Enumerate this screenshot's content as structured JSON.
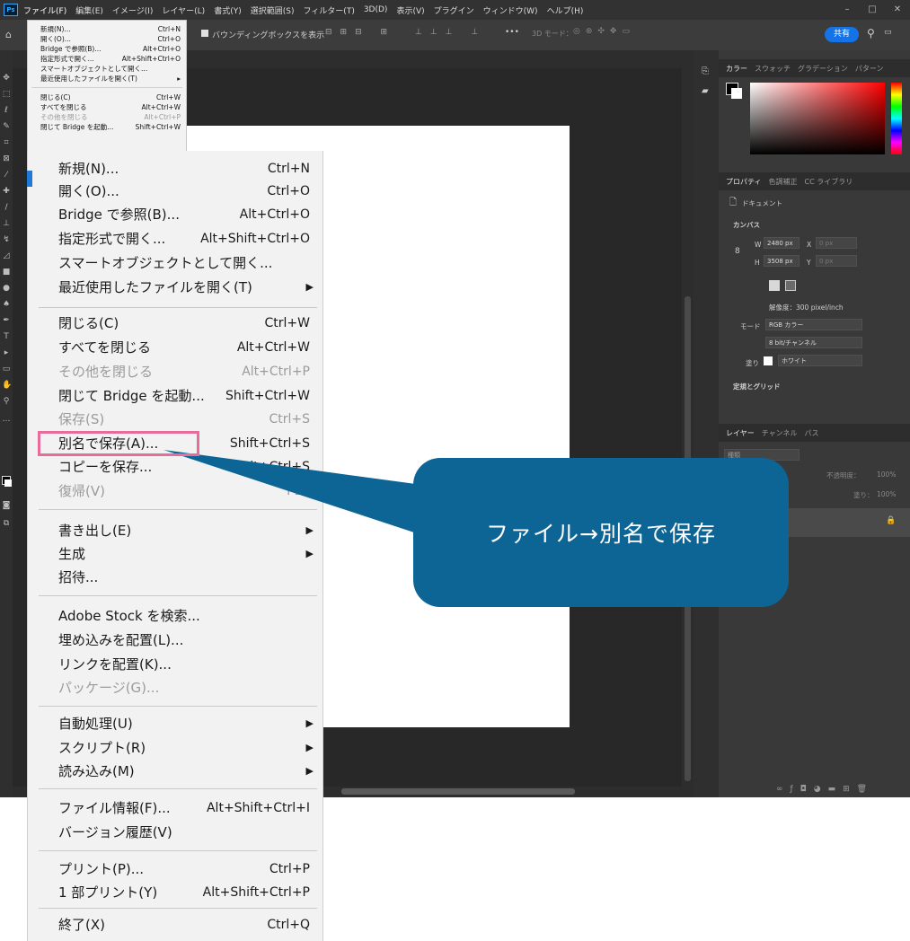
{
  "menubar": {
    "logo": "Ps",
    "items": [
      "ファイル(F)",
      "編集(E)",
      "イメージ(I)",
      "レイヤー(L)",
      "書式(Y)",
      "選択範囲(S)",
      "フィルター(T)",
      "3D(D)",
      "表示(V)",
      "プラグイン",
      "ウィンドウ(W)",
      "ヘルプ(H)"
    ]
  },
  "optionsbar": {
    "bounding_box": "バウンディングボックスを表示",
    "mode_3d": "3D モード：",
    "share": "共有",
    "more": "•••"
  },
  "mini_menu": {
    "items": [
      {
        "label": "新規(N)...",
        "shortcut": "Ctrl+N"
      },
      {
        "label": "開く(O)...",
        "shortcut": "Ctrl+O"
      },
      {
        "label": "Bridge で参照(B)...",
        "shortcut": "Alt+Ctrl+O"
      },
      {
        "label": "指定形式で開く...",
        "shortcut": "Alt+Shift+Ctrl+O"
      },
      {
        "label": "スマートオブジェクトとして開く...",
        "shortcut": ""
      },
      {
        "label": "最近使用したファイルを開く(T)",
        "shortcut": "▸"
      },
      {
        "label": "閉じる(C)",
        "shortcut": "Ctrl+W"
      },
      {
        "label": "すべてを閉じる",
        "shortcut": "Alt+Ctrl+W"
      },
      {
        "label": "その他を閉じる",
        "shortcut": "Alt+Ctrl+P"
      },
      {
        "label": "閉じて Bridge を起動...",
        "shortcut": "Shift+Ctrl+W"
      }
    ]
  },
  "file_menu": {
    "items": [
      {
        "label": "新規(N)...",
        "shortcut": "Ctrl+N"
      },
      {
        "label": "開く(O)...",
        "shortcut": "Ctrl+O"
      },
      {
        "label": "Bridge で参照(B)...",
        "shortcut": "Alt+Ctrl+O"
      },
      {
        "label": "指定形式で開く...",
        "shortcut": "Alt+Shift+Ctrl+O"
      },
      {
        "label": "スマートオブジェクトとして開く...",
        "shortcut": ""
      },
      {
        "label": "最近使用したファイルを開く(T)",
        "shortcut": "▶"
      },
      {
        "label": "閉じる(C)",
        "shortcut": "Ctrl+W"
      },
      {
        "label": "すべてを閉じる",
        "shortcut": "Alt+Ctrl+W"
      },
      {
        "label": "その他を閉じる",
        "shortcut": "Alt+Ctrl+P"
      },
      {
        "label": "閉じて Bridge を起動...",
        "shortcut": "Shift+Ctrl+W"
      },
      {
        "label": "保存(S)",
        "shortcut": "Ctrl+S"
      },
      {
        "label": "別名で保存(A)...",
        "shortcut": "Shift+Ctrl+S"
      },
      {
        "label": "コピーを保存...",
        "shortcut": "Alt+Ctrl+S"
      },
      {
        "label": "復帰(V)",
        "shortcut": "F12"
      },
      {
        "label": "書き出し(E)",
        "shortcut": "▶"
      },
      {
        "label": "生成",
        "shortcut": "▶"
      },
      {
        "label": "招待...",
        "shortcut": ""
      },
      {
        "label": "Adobe Stock を検索...",
        "shortcut": ""
      },
      {
        "label": "埋め込みを配置(L)...",
        "shortcut": ""
      },
      {
        "label": "リンクを配置(K)...",
        "shortcut": ""
      },
      {
        "label": "パッケージ(G)...",
        "shortcut": ""
      },
      {
        "label": "自動処理(U)",
        "shortcut": "▶"
      },
      {
        "label": "スクリプト(R)",
        "shortcut": "▶"
      },
      {
        "label": "読み込み(M)",
        "shortcut": "▶"
      },
      {
        "label": "ファイル情報(F)...",
        "shortcut": "Alt+Shift+Ctrl+I"
      },
      {
        "label": "バージョン履歴(V)",
        "shortcut": ""
      },
      {
        "label": "プリント(P)...",
        "shortcut": "Ctrl+P"
      },
      {
        "label": "1 部プリント(Y)",
        "shortcut": "Alt+Shift+Ctrl+P"
      },
      {
        "label": "終了(X)",
        "shortcut": "Ctrl+Q"
      }
    ]
  },
  "color_panel": {
    "tabs": [
      "カラー",
      "スウォッチ",
      "グラデーション",
      "パターン"
    ]
  },
  "properties_panel": {
    "tabs": [
      "プロパティ",
      "色調補正",
      "CC ライブラリ"
    ],
    "doc_label": "ドキュメント",
    "canvas_section": "カンバス",
    "w_label": "W",
    "w_value": "2480 px",
    "h_label": "H",
    "h_value": "3508 px",
    "x_label": "X",
    "x_value": "0 px",
    "y_label": "Y",
    "y_value": "0 px",
    "resolution": "解像度：300 pixel/inch",
    "mode_label": "モード",
    "mode_value": "RGB カラー",
    "bit_value": "8 bit/チャンネル",
    "fill_label": "塗り",
    "fill_value": "ホワイト",
    "guides_section": "定規とグリッド"
  },
  "layers_panel": {
    "tabs": [
      "レイヤー",
      "チャンネル",
      "パス"
    ],
    "search": "種類",
    "opacity_label": "不透明度：",
    "opacity_value": "100%",
    "fill_label": "塗り：",
    "fill_value": "100%"
  },
  "callout": {
    "text": "ファイル→別名で保存"
  },
  "colors": {
    "accent": "#31a8ff",
    "callout": "#0d6595",
    "highlight": "#e86c9a",
    "share": "#1473e6"
  }
}
